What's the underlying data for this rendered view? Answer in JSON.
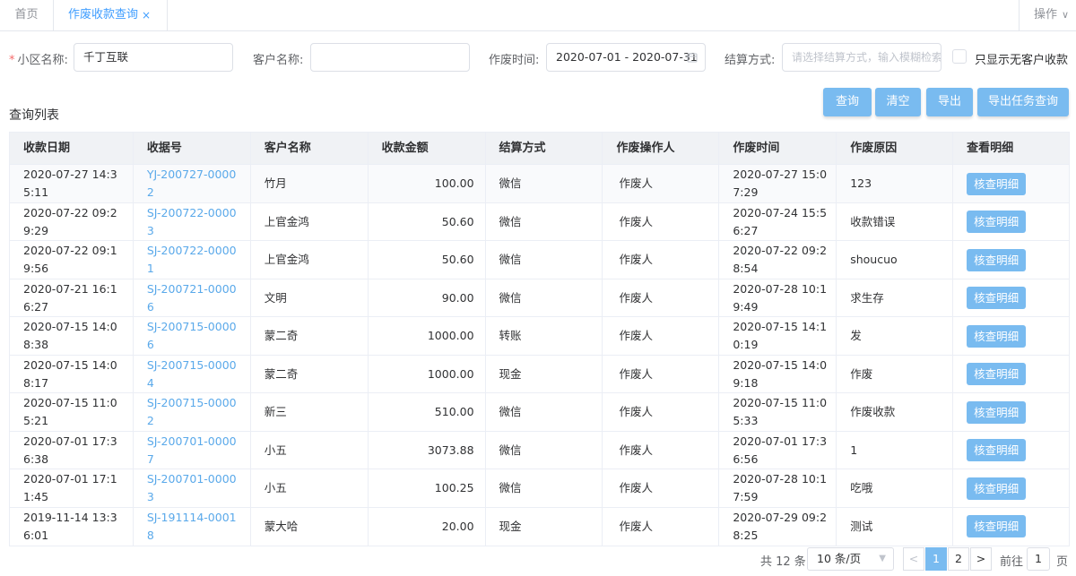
{
  "tabs": {
    "home": "首页",
    "active": "作废收款查询",
    "close": "×",
    "ops": "操作",
    "ops_chevron": "∨"
  },
  "filters": {
    "community_label": "小区名称:",
    "community_required": "*",
    "community_value": "千丁互联",
    "customer_label": "客户名称:",
    "customer_value": "",
    "void_time_label": "作废时间:",
    "void_time_value": "2020-07-01 - 2020-07-31",
    "settle_label": "结算方式:",
    "settle_placeholder": "请选择结算方式，输入模糊检索",
    "only_no_customer_label": "只显示无客户收款"
  },
  "section": {
    "title": "查询列表"
  },
  "buttons": {
    "query": "查询",
    "clear": "清空",
    "export": "导出",
    "export_task": "导出任务查询"
  },
  "table": {
    "headers": [
      "收款日期",
      "收据号",
      "客户名称",
      "收款金额",
      "结算方式",
      "作废操作人",
      "作废时间",
      "作废原因",
      "查看明细"
    ],
    "detail_label": "核查明细",
    "rows": [
      {
        "date": "2020-07-27 14:35:11",
        "receipt": "YJ-200727-00002",
        "customer": "竹月",
        "amount": "100.00",
        "method": "微信",
        "operator": "作废人",
        "void_time": "2020-07-27 15:07:29",
        "reason": "123"
      },
      {
        "date": "2020-07-22 09:29:29",
        "receipt": "SJ-200722-00003",
        "customer": "上官金鸿",
        "amount": "50.60",
        "method": "微信",
        "operator": "作废人",
        "void_time": "2020-07-24 15:56:27",
        "reason": "收款错误"
      },
      {
        "date": "2020-07-22 09:19:56",
        "receipt": "SJ-200722-00001",
        "customer": "上官金鸿",
        "amount": "50.60",
        "method": "微信",
        "operator": "作废人",
        "void_time": "2020-07-22 09:28:54",
        "reason": "shoucuo"
      },
      {
        "date": "2020-07-21 16:16:27",
        "receipt": "SJ-200721-00006",
        "customer": "文明",
        "amount": "90.00",
        "method": "微信",
        "operator": "作废人",
        "void_time": "2020-07-28 10:19:49",
        "reason": "求生存"
      },
      {
        "date": "2020-07-15 14:08:38",
        "receipt": "SJ-200715-00006",
        "customer": "蒙二奇",
        "amount": "1000.00",
        "method": "转账",
        "operator": "作废人",
        "void_time": "2020-07-15 14:10:19",
        "reason": "发"
      },
      {
        "date": "2020-07-15 14:08:17",
        "receipt": "SJ-200715-00004",
        "customer": "蒙二奇",
        "amount": "1000.00",
        "method": "现金",
        "operator": "作废人",
        "void_time": "2020-07-15 14:09:18",
        "reason": "作废"
      },
      {
        "date": "2020-07-15 11:05:21",
        "receipt": "SJ-200715-00002",
        "customer": "新三",
        "amount": "510.00",
        "method": "微信",
        "operator": "作废人",
        "void_time": "2020-07-15 11:05:33",
        "reason": "作废收款"
      },
      {
        "date": "2020-07-01 17:36:38",
        "receipt": "SJ-200701-00007",
        "customer": "小五",
        "amount": "3073.88",
        "method": "微信",
        "operator": "作废人",
        "void_time": "2020-07-01 17:36:56",
        "reason": "1"
      },
      {
        "date": "2020-07-01 17:11:45",
        "receipt": "SJ-200701-00003",
        "customer": "小五",
        "amount": "100.25",
        "method": "微信",
        "operator": "作废人",
        "void_time": "2020-07-28 10:17:59",
        "reason": "吃哦"
      },
      {
        "date": "2019-11-14 13:36:01",
        "receipt": "SJ-191114-00018",
        "customer": "蒙大哈",
        "amount": "20.00",
        "method": "现金",
        "operator": "作废人",
        "void_time": "2020-07-29 09:28:25",
        "reason": "测试"
      }
    ]
  },
  "pagination": {
    "total": "共 12 条",
    "page_size": "10 条/页",
    "prev": "<",
    "next": ">",
    "pages": [
      "1",
      "2"
    ],
    "current": "1",
    "goto_label": "前往",
    "goto_value": "1",
    "page_suffix": "页"
  },
  "colors": {
    "accent": "#409eff",
    "button": "#79bbf0",
    "link": "#5aa9ea",
    "required": "#f56c6c"
  },
  "icons": {
    "calendar": "calendar-icon",
    "close": "close-icon",
    "chevron": "chevron-down-icon"
  }
}
